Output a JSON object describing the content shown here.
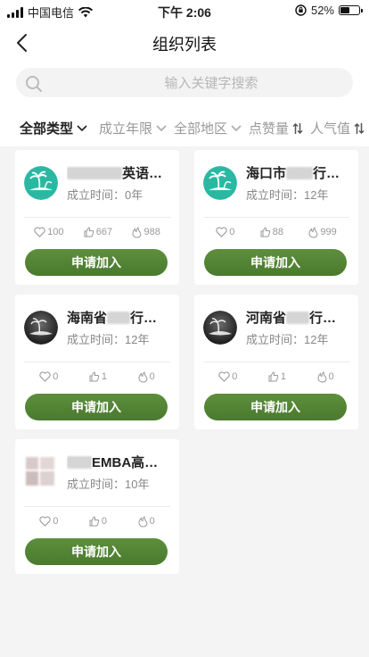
{
  "status_bar": {
    "carrier": "中国电信",
    "time": "下午 2:06",
    "battery": "52%",
    "battery_level": 0.52
  },
  "nav": {
    "title": "组织列表"
  },
  "search": {
    "placeholder": "输入关键字搜索"
  },
  "filters": [
    {
      "label": "全部类型",
      "active": true,
      "icon": "chevron-down-icon"
    },
    {
      "label": "成立年限",
      "active": false,
      "icon": "chevron-down-icon"
    },
    {
      "label": "全部地区",
      "active": false,
      "icon": "chevron-down-icon"
    },
    {
      "label": "点赞量",
      "active": false,
      "icon": "sort-icon"
    },
    {
      "label": "人气值",
      "active": false,
      "icon": "sort-icon"
    }
  ],
  "cards": [
    {
      "name_suffix": "英语…",
      "name_prefix": "",
      "years": "成立时间：0年",
      "likes": "100",
      "thumbs": "667",
      "hot": "988",
      "button": "申请加入",
      "avatar": "palm-island-logo"
    },
    {
      "name_prefix": "海口市",
      "name_suffix": "行…",
      "years": "成立时间：12年",
      "likes": "0",
      "thumbs": "88",
      "hot": "999",
      "button": "申请加入",
      "avatar": "palm-island-logo"
    },
    {
      "name_prefix": "海南省",
      "name_suffix": "行…",
      "years": "成立时间：12年",
      "likes": "0",
      "thumbs": "1",
      "hot": "0",
      "button": "申请加入",
      "avatar": "dark-island-logo"
    },
    {
      "name_prefix": "河南省",
      "name_suffix": "行…",
      "years": "成立时间：12年",
      "likes": "0",
      "thumbs": "1",
      "hot": "0",
      "button": "申请加入",
      "avatar": "dark-island-logo"
    },
    {
      "name_prefix": "",
      "name_suffix": "EMBA高…",
      "years": "成立时间：10年",
      "likes": "0",
      "thumbs": "0",
      "hot": "0",
      "button": "申请加入",
      "avatar": "blurred-logo"
    }
  ],
  "colors": {
    "accent_green": "#4a7a2e",
    "teal_logo": "#2bb8a3"
  }
}
